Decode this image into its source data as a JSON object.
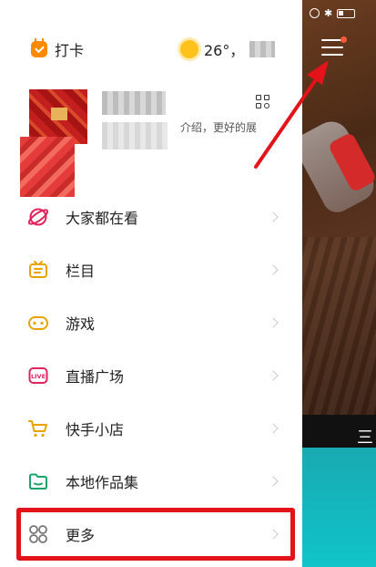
{
  "header": {
    "checkin_label": "打卡",
    "weather_temp": "26°，",
    "weather_icon": "sun-icon"
  },
  "profile": {
    "intro_text": "介绍，更好的展"
  },
  "menu": {
    "items": [
      {
        "label": "大家都在看",
        "icon": "planet-icon",
        "color": "#e0245e"
      },
      {
        "label": "栏目",
        "icon": "tv-column-icon",
        "color": "#e8a300"
      },
      {
        "label": "游戏",
        "icon": "gamepad-icon",
        "color": "#e8a300"
      },
      {
        "label": "直播广场",
        "icon": "live-icon",
        "color": "#e0245e"
      },
      {
        "label": "快手小店",
        "icon": "cart-icon",
        "color": "#e8a300"
      },
      {
        "label": "本地作品集",
        "icon": "folder-icon",
        "color": "#1aa46a"
      },
      {
        "label": "更多",
        "icon": "grid-icon",
        "color": "#777777"
      }
    ]
  },
  "colors": {
    "highlight": "#e4131a",
    "accent_orange": "#ff8a00"
  },
  "background": {
    "tab_label": "三"
  }
}
